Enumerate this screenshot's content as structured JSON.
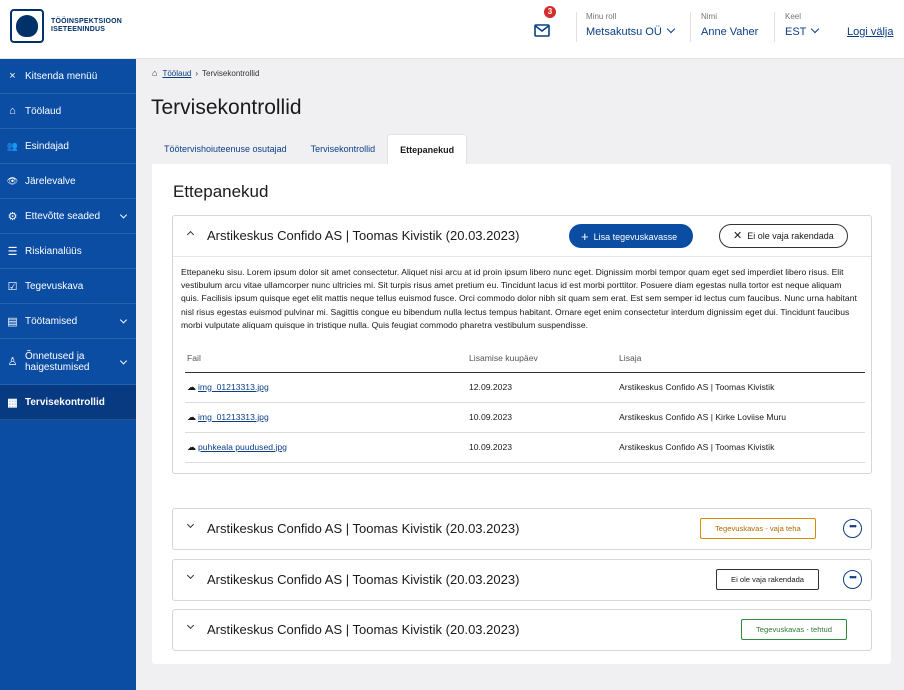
{
  "header": {
    "logo_line1": "TÖÖINSPEKTSIOON",
    "logo_line2": "ISETEENINDUS",
    "mail_badge": "3",
    "role_label": "Minu roll",
    "role_value": "Metsakutsu OÜ",
    "name_label": "Nimi",
    "name_value": "Anne Vaher",
    "lang_label": "Keel",
    "lang_value": "EST",
    "logout": "Logi välja"
  },
  "sidebar": {
    "items": [
      {
        "label": "Kitsenda menüü",
        "icon": "×"
      },
      {
        "label": "Töölaud",
        "icon": "⌂"
      },
      {
        "label": "Esindajad",
        "icon": "👥"
      },
      {
        "label": "Järelevalve",
        "icon": "👁"
      },
      {
        "label": "Ettevõtte seaded",
        "icon": "⚙"
      },
      {
        "label": "Riskianalüüs",
        "icon": "☰"
      },
      {
        "label": "Tegevuskava",
        "icon": "☑"
      },
      {
        "label": "Töötamised",
        "icon": "▤"
      },
      {
        "label": "Õnnetused ja haigestumised",
        "icon": "♙"
      },
      {
        "label": "Tervisekontrollid",
        "icon": "▦"
      }
    ]
  },
  "breadcrumb": {
    "home": "Töölaud",
    "current": "Tervisekontrollid"
  },
  "page_title": "Tervisekontrollid",
  "tabs": [
    "Töötervishoiuteenuse osutajad",
    "Tervisekontrollid",
    "Ettepanekud"
  ],
  "section_title": "Ettepanekud",
  "accordions": [
    {
      "title": "Arstikeskus Confido AS | Toomas Kivistik (20.03.2023)",
      "add_button": "Lisa tegevuskavasse",
      "reject_button": "Ei ole vaja rakendada",
      "body": "Ettepaneku sisu. Lorem ipsum dolor sit amet consectetur. Aliquet nisi arcu at id proin ipsum libero nunc eget. Dignissim morbi tempor quam eget sed imperdiet libero risus. Elit vestibulum arcu vitae ullamcorper nunc ultricies mi. Sit turpis risus amet pretium eu. Tincidunt lacus id est morbi porttitor. Posuere diam egestas nulla tortor est neque aliquam quis. Facilisis ipsum quisque eget elit mattis neque tellus euismod fusce. Orci commodo dolor nibh sit quam sem erat. Est sem semper id lectus cum faucibus. Nunc urna habitant nisl risus egestas euismod pulvinar mi. Sagittis congue eu bibendum nulla lectus tempus habitant. Ornare eget enim consectetur interdum dignissim eget dui. Tincidunt faucibus morbi vulputate aliquam quisque in tristique nulla. Quis feugiat commodo pharetra vestibulum suspendisse.",
      "columns": [
        "Fail",
        "Lisamise kuupäev",
        "Lisaja"
      ],
      "rows": [
        {
          "file": "img_01213313.jpg",
          "date": "12.09.2023",
          "author": "Arstikeskus Confido AS | Toomas Kivistik"
        },
        {
          "file": "img_01213313.jpg",
          "date": "10.09.2023",
          "author": "Arstikeskus Confido AS | Kirke Loviise Muru"
        },
        {
          "file": "puhkeala puudused.jpg",
          "date": "10.09.2023",
          "author": "Arstikeskus Confido AS | Toomas Kivistik"
        }
      ]
    },
    {
      "title": "Arstikeskus Confido AS | Toomas Kivistik (20.03.2023)",
      "status": "Tegevuskavas - vaja teha"
    },
    {
      "title": "Arstikeskus Confido AS | Toomas Kivistik (20.03.2023)",
      "status": "Ei ole vaja rakendada"
    },
    {
      "title": "Arstikeskus Confido AS | Toomas Kivistik (20.03.2023)",
      "status": "Tegevuskavas - tehtud"
    }
  ],
  "colors": {
    "brand": "#0a4da3",
    "sidebar_active": "#073a80",
    "link": "#0a3e85",
    "orange": "#d98b00",
    "green": "#2e8b3e",
    "badge": "#d62b2b"
  }
}
